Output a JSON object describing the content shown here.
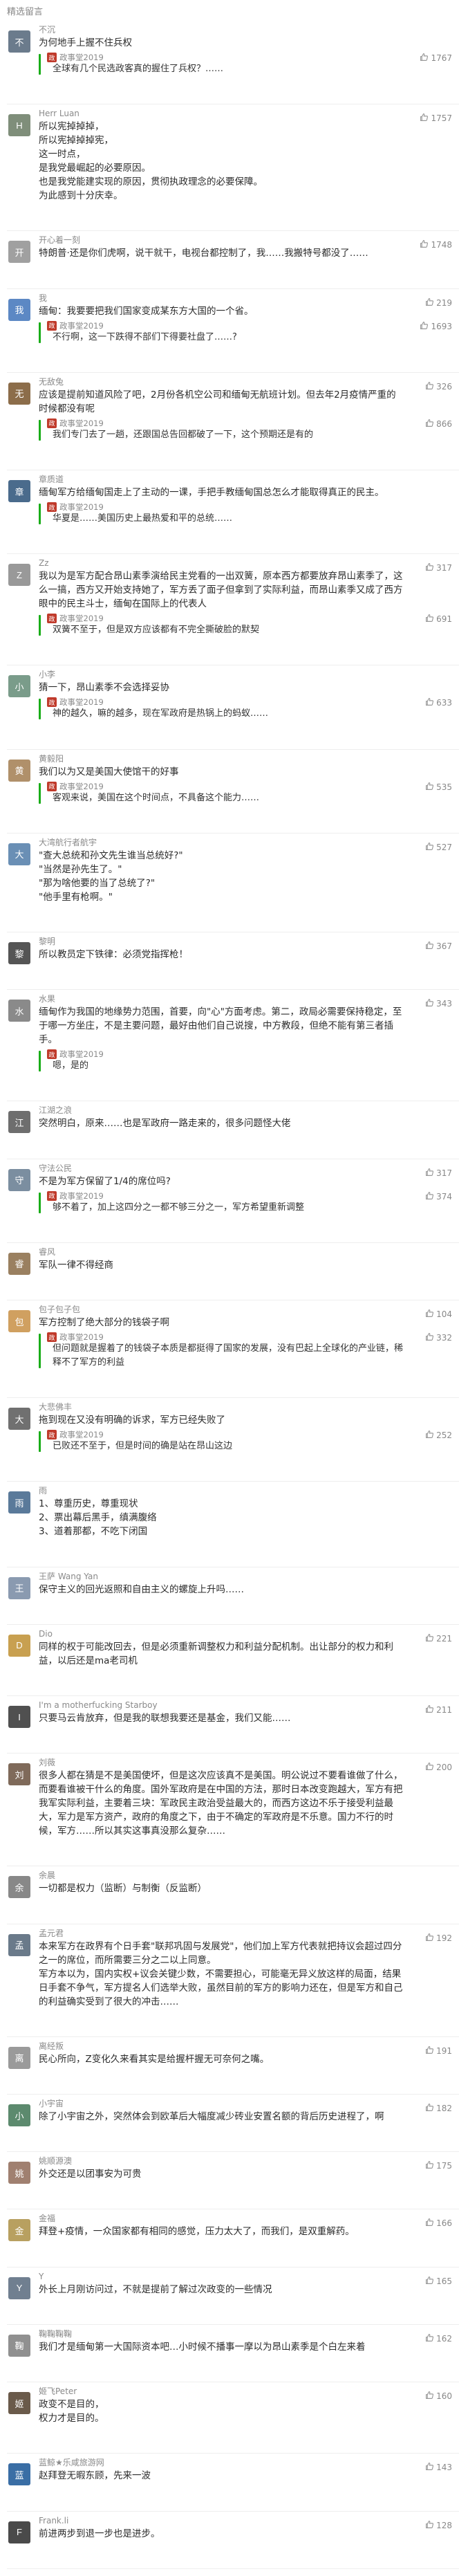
{
  "header": {
    "title": "精选留言"
  },
  "colors": {
    "reply_bar": "#1aad19",
    "text": "#2b2b2b",
    "muted": "#8a8a8a",
    "author_avatar": "#c03a2b"
  },
  "comments": [
    {
      "name": "不沉",
      "text": "为何地手上握不住兵权",
      "likes": "",
      "avatar_color": "#6b7b8c",
      "avatar_letter": "不",
      "reply": {
        "name": "政事堂2019",
        "text": "全球有几个民选政客真的握住了兵权？……",
        "likes": "1767"
      }
    },
    {
      "name": "Herr Luan",
      "text": "所以宪掉掉掉，\n所以宪掉掉掉宪，\n这一时点，\n是我党最崛起的必要原因。\n也是我党能建实现的原因，贯彻执政理念的必要保障。\n为此感到十分庆幸。",
      "likes": "1757",
      "avatar_color": "#7f8e7a",
      "avatar_letter": "H",
      "reply": null
    },
    {
      "name": "开心着一刻",
      "text": "特朗普·还是你们虎啊，说干就干，电视台都控制了，我……我搬特号都没了……",
      "likes": "1748",
      "avatar_color": "#a0a0a0",
      "avatar_letter": "开",
      "reply": null
    },
    {
      "name": "我",
      "text": "缅甸：我要要把我们国家变成某东方大国的一个省。",
      "likes": "219",
      "avatar_color": "#5c88c4",
      "avatar_letter": "我",
      "reply": {
        "name": "政事堂2019",
        "text": "不行啊，这一下跌得不部们下得要社盘了……?",
        "likes": "1693"
      }
    },
    {
      "name": "无敌兔",
      "text": "应该是提前知道风险了吧，2月份各机空公司和缅甸无航班计划。但去年2月疫情严重的时候都没有呢",
      "likes": "326",
      "avatar_color": "#8c6d4a",
      "avatar_letter": "无",
      "reply": {
        "name": "政事堂2019",
        "text": "我们专门去了一趟，还跟国总告回都破了一下，这个预期还是有的",
        "likes": "866"
      }
    },
    {
      "name": "章质道",
      "text": "缅甸军方给缅甸国走上了主动的一课，手把手教缅甸国总怎么才能取得真正的民主。",
      "likes": "",
      "avatar_color": "#4a6b8c",
      "avatar_letter": "章",
      "reply": {
        "name": "政事堂2019",
        "text": "华夏是……美国历史上最热爱和平的总统……",
        "likes": ""
      }
    },
    {
      "name": "Zz",
      "text": "我以为是军方配合昂山素季演给民主党看的一出双簧，原本西方都要放弃昂山素季了，这么一搞，西方又开始支持她了，军方丢了面子但拿到了实际利益，而昂山素季又成了西方眼中的民主斗士，缅甸在国际上的代表人",
      "likes": "317",
      "avatar_color": "#999",
      "avatar_letter": "Z",
      "reply": {
        "name": "政事堂2019",
        "text": "双簧不至于，但是双方应该都有不完全撕破脸的默契",
        "likes": "691"
      }
    },
    {
      "name": "小李",
      "text": "猜一下，昂山素季不会选择妥协",
      "likes": "",
      "avatar_color": "#7a9c8a",
      "avatar_letter": "小",
      "reply": {
        "name": "政事堂2019",
        "text": "神的越久，嘛的越多，现在军政府是热锅上的蚂蚁……",
        "likes": "633"
      }
    },
    {
      "name": "黄毅阳",
      "text": "我们以为又是美国大使馆干的好事",
      "likes": "",
      "avatar_color": "#b0906a",
      "avatar_letter": "黄",
      "reply": {
        "name": "政事堂2019",
        "text": "客观来说，美国在这个时间点，不具备这个能力……",
        "likes": "535"
      }
    },
    {
      "name": "大湾航行者航宇",
      "text": "\"查大总统和孙文先生谁当总统好?\"\n\"当然是孙先生了。\"\n\"那为啥他要的当了总统了?\"\n\"他手里有枪啊。\"",
      "likes": "527",
      "avatar_color": "#6a8fb5",
      "avatar_letter": "大",
      "reply": null
    },
    {
      "name": "黎明",
      "text": "所以教员定下铁律：必须党指挥枪！",
      "likes": "367",
      "avatar_color": "#555",
      "avatar_letter": "黎",
      "reply": null
    },
    {
      "name": "水果",
      "text": "缅甸作为我国的地缘势力范围，首要，向\"心\"方面考虑。第二，政局必需要保持稳定，至于哪一方坐庄，不是主要问题，最好由他们自己说搜，中方教段，但绝不能有第三者插手。",
      "likes": "343",
      "avatar_color": "#8a8a8a",
      "avatar_letter": "水",
      "reply": {
        "name": "政事堂2019",
        "text": "嗯，是的",
        "likes": ""
      }
    },
    {
      "name": "江湖之浪",
      "text": "突然明白，原来……也是军政府一路走来的，很多问题怪大佬",
      "likes": "",
      "avatar_color": "#6e6e6e",
      "avatar_letter": "江",
      "reply": null
    },
    {
      "name": "守法公民",
      "text": "不是为军方保留了1/4的席位吗?",
      "likes": "317",
      "avatar_color": "#7b8ea0",
      "avatar_letter": "守",
      "reply": {
        "name": "政事堂2019",
        "text": "够不着了，加上这四分之一都不够三分之一，军方希望重新调整",
        "likes": "374"
      }
    },
    {
      "name": "睿风",
      "text": "军队一律不得经商",
      "likes": "",
      "avatar_color": "#9a8060",
      "avatar_letter": "睿",
      "reply": null
    },
    {
      "name": "包子包子包",
      "text": "军方控制了绝大部分的钱袋子啊",
      "likes": "104",
      "avatar_color": "#d0a060",
      "avatar_letter": "包",
      "reply": {
        "name": "政事堂2019",
        "text": "但问题就是握着了的钱袋子本质是都挺得了国家的发展，没有巴起上全球化的产业链，稀释不了军方的利益",
        "likes": "332"
      }
    },
    {
      "name": "大悲佛丰",
      "text": "拖到现在又没有明确的诉求，军方已经失败了",
      "likes": "",
      "avatar_color": "#707070",
      "avatar_letter": "大",
      "reply": {
        "name": "政事堂2019",
        "text": "已败还不至于，但是时间的确是站在昂山这边",
        "likes": "252"
      }
    },
    {
      "name": "雨",
      "text": "1、尊重历史，尊重现状\n2、票出幕后黑手，缜满腹络\n3、道着那都，不吃下闭国",
      "likes": "",
      "avatar_color": "#5a7a9a",
      "avatar_letter": "雨",
      "reply": null
    },
    {
      "name": "王萨 Wang Yan",
      "text": "保守主义的回光返照和自由主义的螺旋上升吗……",
      "likes": "",
      "avatar_color": "#8a9ab0",
      "avatar_letter": "王",
      "reply": null
    },
    {
      "name": "Dio",
      "text": "同样的权于可能改回去，但是必须重新调整权力和利益分配机制。出让部分的权力和利益，以后还是ma老司机",
      "likes": "221",
      "avatar_color": "#c8a050",
      "avatar_letter": "D",
      "reply": null
    },
    {
      "name": "I'm a motherfucking Starboy",
      "text": "只要马云肯放弃，但是我的联想我要还是基金，我们又能……",
      "likes": "211",
      "avatar_color": "#505050",
      "avatar_letter": "I",
      "reply": null
    },
    {
      "name": "刘薇",
      "text": "很多人都在猜是不是美国使坏，但是这次应该真不是美国。明公说过不要看谁做了什么，而要看谁被干什么的角度。国外军政府是在中国的方法，那时日本改变跑越大，军方有把我军实际利益，主要着三块：军政民主政治受益最大的，而西方这边不乐于接受利益最大，军力是军方资产，政府的角度之下，由于不确定的军政府是不乐意。国力不行的时候，军方……所以其实这事真没那么复杂……",
      "likes": "200",
      "avatar_color": "#7f6a5a",
      "avatar_letter": "刘",
      "reply": null
    },
    {
      "name": "余晨",
      "text": "一切都是权力（监断）与制衡（反监断）",
      "likes": "",
      "avatar_color": "#888",
      "avatar_letter": "余",
      "reply": null
    },
    {
      "name": "孟元君",
      "text": "本来军方在政界有个日手套\"联邦巩固与发展党\"，他们加上军方代表就把持议会超过四分之一的席位，而所需要三分之二以上同意。\n军方本以为，国内实权+议会关键少数，不需要担心，可能毫无异义放这样的局面，结果日手套不争气，军方提名人们选举大败，虽然目前的军方的影响力还在，但是军方和自己的利益确实受到了很大的冲击……",
      "likes": "192",
      "avatar_color": "#6a7a8a",
      "avatar_letter": "孟",
      "reply": null
    },
    {
      "name": "离经叛",
      "text": "民心所向，Z变化久来看其实是给握杆握无可奈何之嘴。",
      "likes": "191",
      "avatar_color": "#9a9a9a",
      "avatar_letter": "离",
      "reply": null
    },
    {
      "name": "小宇宙",
      "text": "除了小宇宙之外，突然体会到欧革后大幅度减少砖业安置名额的背后历史进程了，啊",
      "likes": "182",
      "avatar_color": "#5c8a6e",
      "avatar_letter": "小",
      "reply": null
    },
    {
      "name": "姚顺源澳",
      "text": "外交还是以团事安为可贵",
      "likes": "175",
      "avatar_color": "#a08070",
      "avatar_letter": "姚",
      "reply": null
    },
    {
      "name": "金福",
      "text": "拜登+疫情，一众国家都有相同的感觉，压力太大了，而我们，是双重解药。",
      "likes": "166",
      "avatar_color": "#b8a060",
      "avatar_letter": "金",
      "reply": null
    },
    {
      "name": "Y",
      "text": "外长上月刚访问过，不就是提前了解过次政变的一些情况",
      "likes": "165",
      "avatar_color": "#707f90",
      "avatar_letter": "Y",
      "reply": null
    },
    {
      "name": "鞠鞠鞠鞠",
      "text": "我们才是缅甸第一大国际资本吧…小时候不播事一摩以为昂山素季是个白左来着",
      "likes": "162",
      "avatar_color": "#909090",
      "avatar_letter": "鞠",
      "reply": null
    },
    {
      "name": "姬飞Peter",
      "text": "政变不是目的，\n权力才是目的。",
      "likes": "160",
      "avatar_color": "#6a5a4a",
      "avatar_letter": "姬",
      "reply": null
    },
    {
      "name": "蓝鲸★乐咸旅游网",
      "text": "赵拜登无暇东顾，先来一波",
      "likes": "143",
      "avatar_color": "#3a6ea5",
      "avatar_letter": "蓝",
      "reply": null
    },
    {
      "name": "Frank.li",
      "text": "前进两步到退一步也是进步。",
      "likes": "128",
      "avatar_color": "#4a4a4a",
      "avatar_letter": "F",
      "reply": null
    }
  ]
}
